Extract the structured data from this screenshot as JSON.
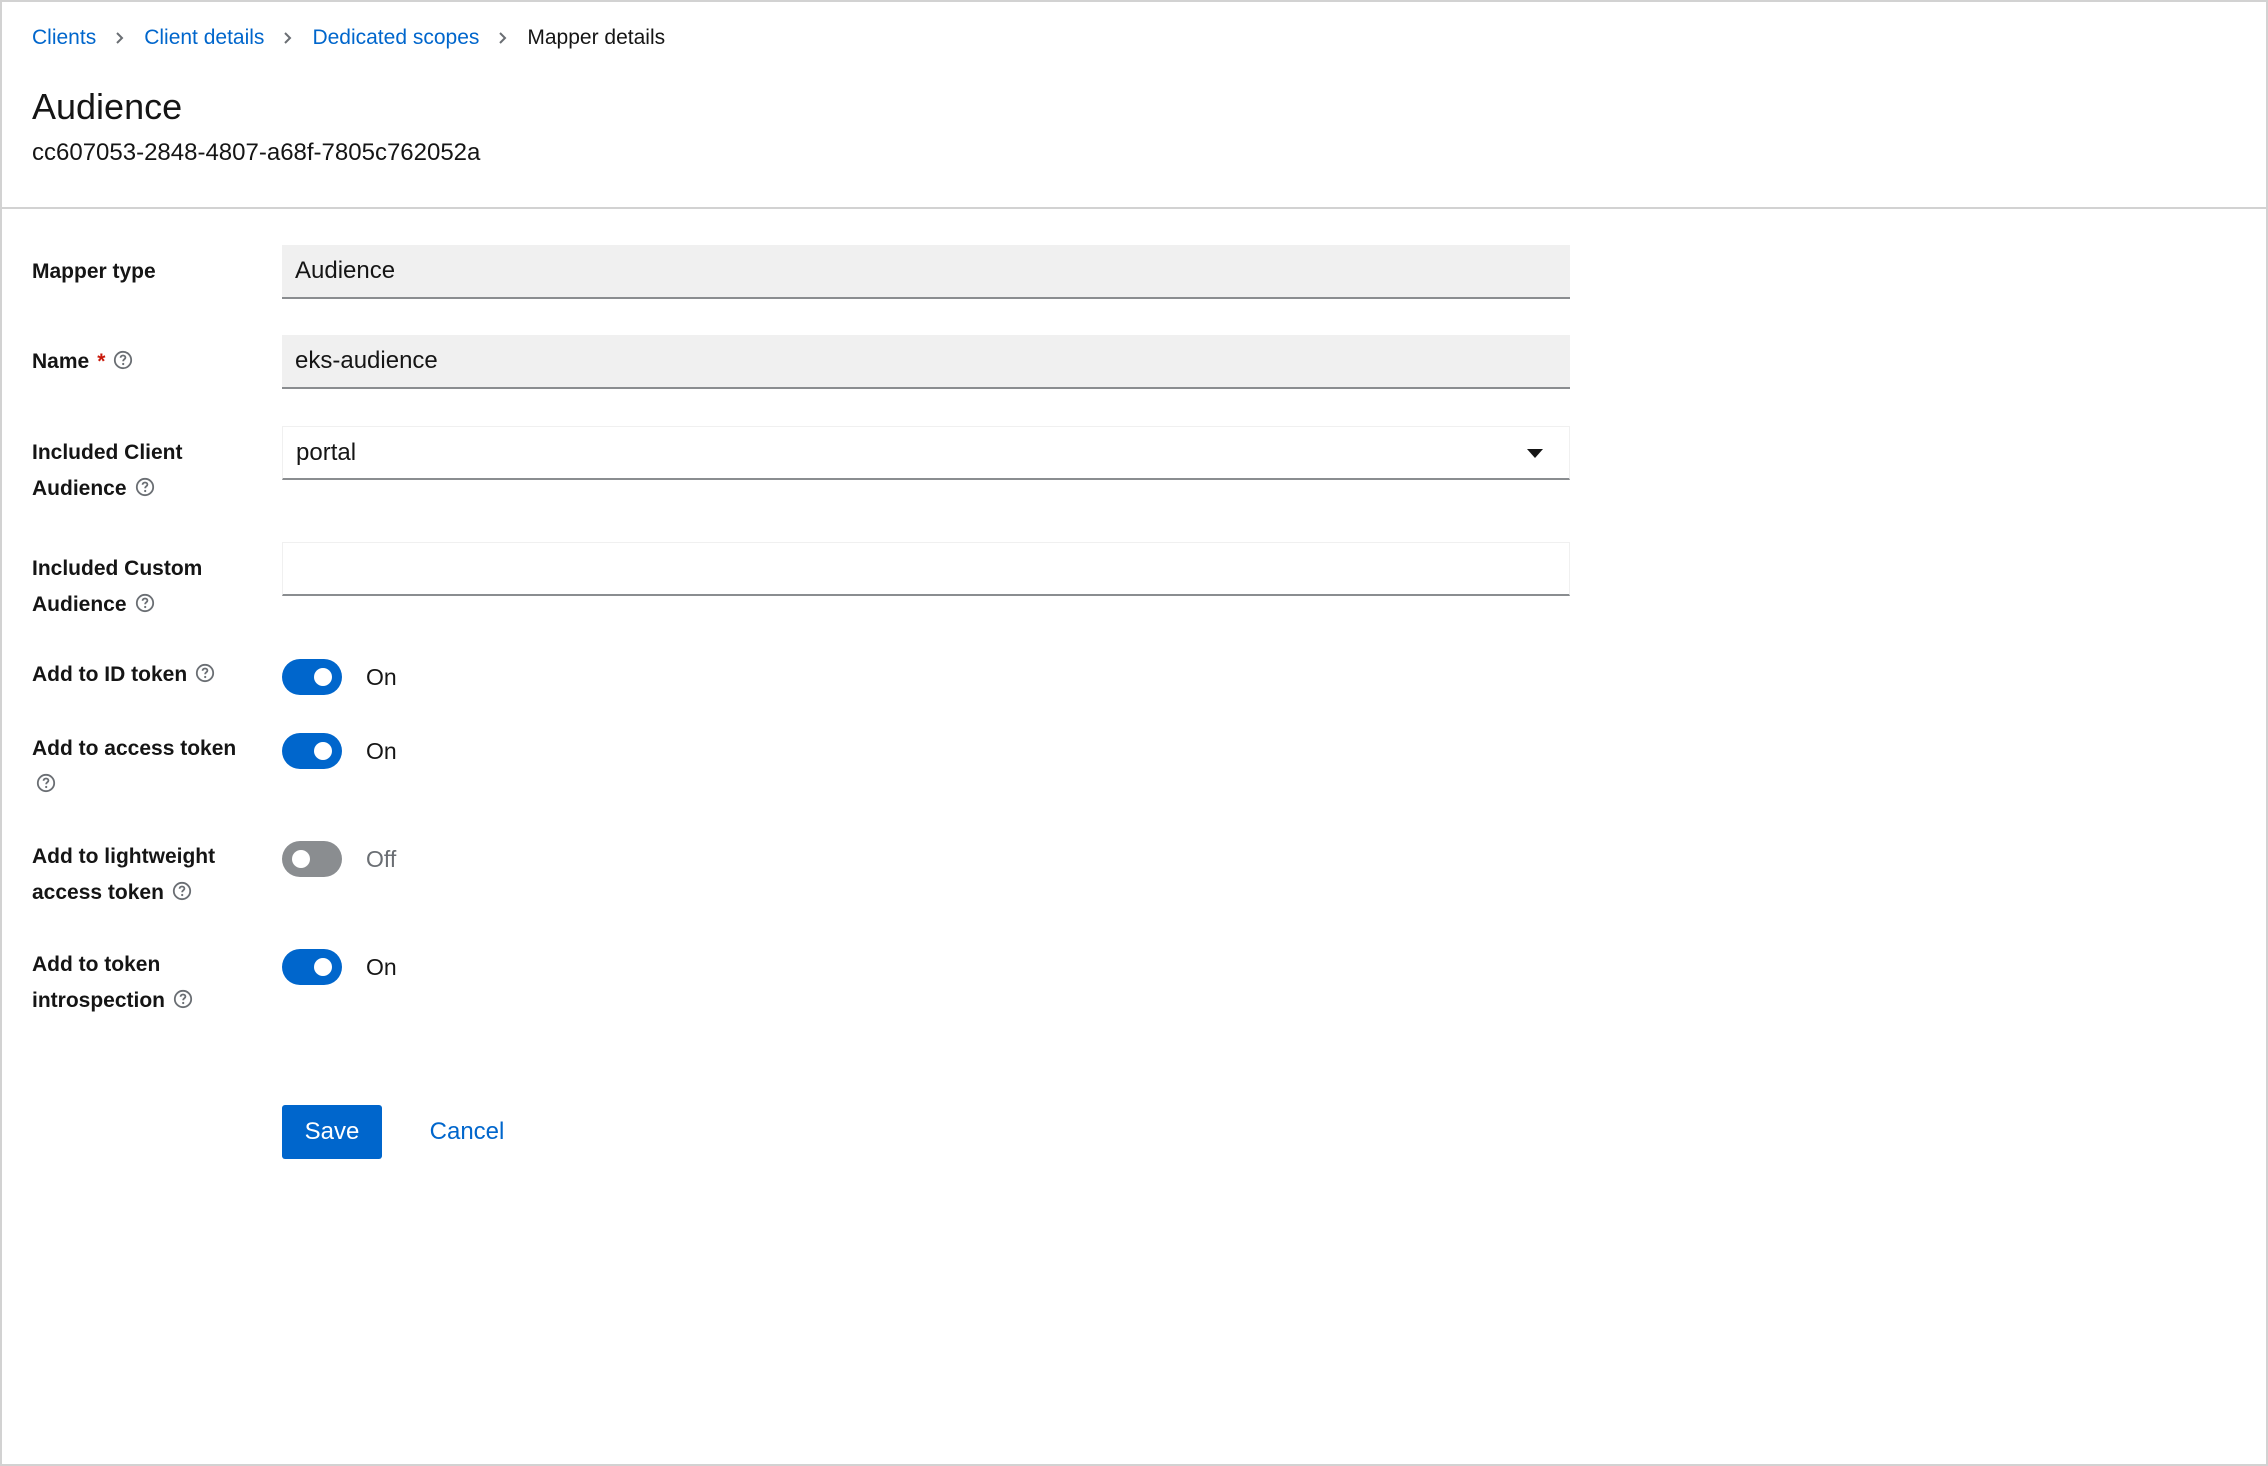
{
  "breadcrumb": {
    "items": [
      {
        "label": "Clients"
      },
      {
        "label": "Client details"
      },
      {
        "label": "Dedicated scopes"
      }
    ],
    "current": "Mapper details"
  },
  "header": {
    "title": "Audience",
    "subtitle": "cc607053-2848-4807-a68f-7805c762052a"
  },
  "form": {
    "mapper_type": {
      "label": "Mapper type",
      "value": "Audience"
    },
    "name": {
      "label": "Name",
      "required_mark": "*",
      "value": "eks-audience"
    },
    "included_client_audience": {
      "label_line1": "Included Client",
      "label_line2": "Audience",
      "value": "portal"
    },
    "included_custom_audience": {
      "label_line1": "Included Custom",
      "label_line2": "Audience",
      "value": ""
    },
    "toggles": [
      {
        "label": "Add to ID token",
        "state": true,
        "text": "On"
      },
      {
        "label": "Add to access token",
        "state": true,
        "text": "On"
      },
      {
        "label_line1": "Add to lightweight",
        "label_line2": "access token",
        "state": false,
        "text": "Off"
      },
      {
        "label_line1": "Add to token",
        "label_line2": "introspection",
        "state": true,
        "text": "On"
      }
    ]
  },
  "actions": {
    "save_label": "Save",
    "cancel_label": "Cancel"
  },
  "colors": {
    "primary": "#0066cc",
    "toggle_off": "#8a8d90",
    "required": "#c9190b"
  },
  "icons": {
    "help": "question-circle-icon",
    "separator": "chevron-right-icon",
    "dropdown": "caret-down-icon"
  }
}
